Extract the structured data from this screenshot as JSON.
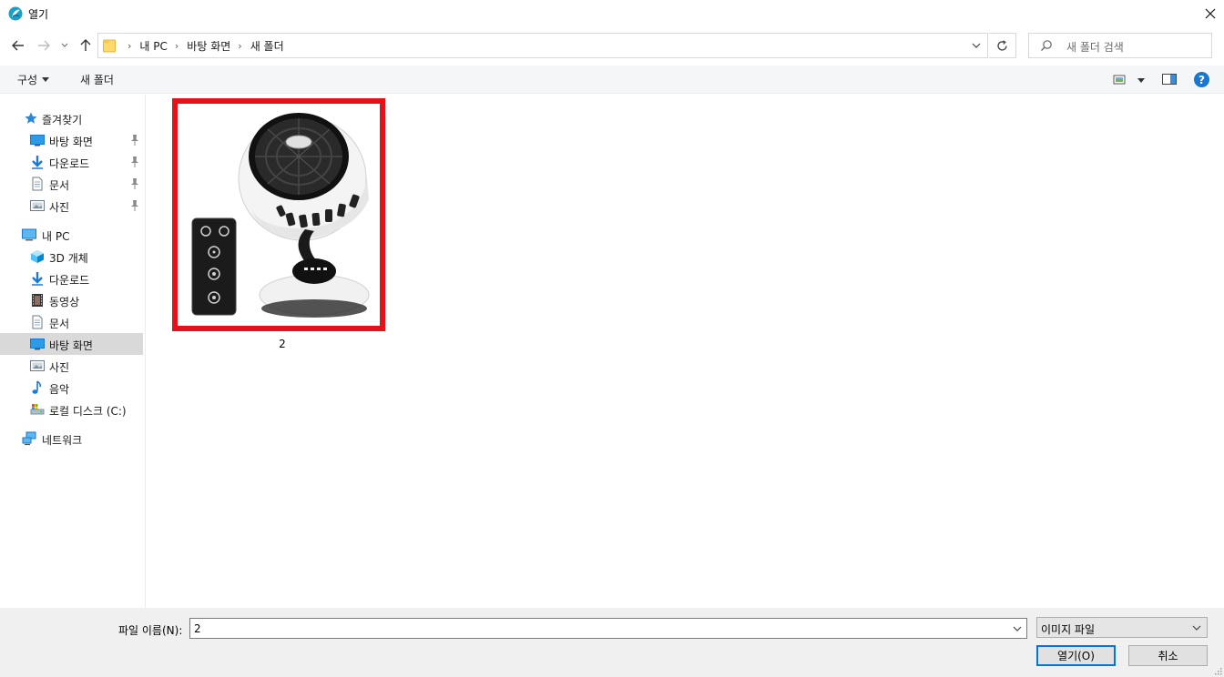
{
  "window": {
    "title": "열기",
    "app_icon": "app-logo-icon",
    "close_icon": "close-icon"
  },
  "nav": {
    "back_icon": "back-arrow-icon",
    "forward_icon": "forward-arrow-icon",
    "recent_icon": "chevron-down-icon",
    "up_icon": "up-arrow-icon"
  },
  "address": {
    "crumbs": [
      "내 PC",
      "바탕 화면",
      "새 폴더"
    ],
    "refresh_icon": "refresh-icon"
  },
  "search": {
    "placeholder": "새 폴더 검색"
  },
  "toolbar": {
    "organize_label": "구성",
    "new_folder_label": "새 폴더",
    "help_label": "?"
  },
  "sidebar": {
    "quick_access": "즐겨찾기",
    "quick_items": [
      "바탕 화면",
      "다운로드",
      "문서",
      "사진"
    ],
    "this_pc": "내 PC",
    "pc_items": [
      "3D 개체",
      "다운로드",
      "동영상",
      "문서",
      "바탕 화면",
      "사진",
      "음악",
      "로컬 디스크 (C:)"
    ],
    "network": "네트워크",
    "selected": "바탕 화면"
  },
  "content": {
    "files": [
      {
        "name": "2",
        "thumbnail": "fan-with-remote-image"
      }
    ]
  },
  "footer": {
    "filename_label": "파일 이름(N):",
    "filename_value": "2",
    "filetype_value": "이미지 파일",
    "open_label": "열기(O)",
    "cancel_label": "취소"
  },
  "colors": {
    "selection_border": "#e3121b",
    "accent": "#0078d7",
    "help": "#1976d2"
  }
}
